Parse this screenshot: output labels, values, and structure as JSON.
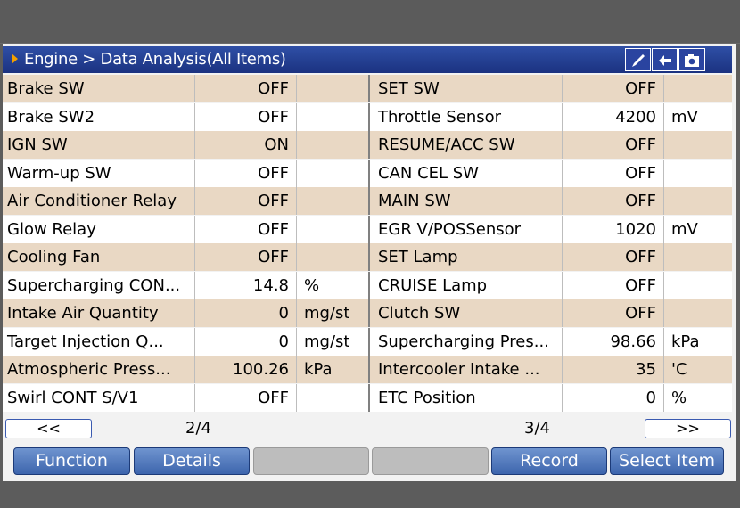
{
  "header": {
    "breadcrumb": "Engine > Data Analysis(All Items)"
  },
  "toolbar": {
    "icons": [
      "brush-icon",
      "back-arrow-icon",
      "camera-icon"
    ]
  },
  "rows": [
    {
      "left": {
        "name": "Brake SW",
        "value": "OFF",
        "unit": ""
      },
      "right": {
        "name": "SET SW",
        "value": "OFF",
        "unit": ""
      }
    },
    {
      "left": {
        "name": "Brake SW2",
        "value": "OFF",
        "unit": ""
      },
      "right": {
        "name": "Throttle Sensor",
        "value": "4200",
        "unit": "mV"
      }
    },
    {
      "left": {
        "name": "IGN SW",
        "value": "ON",
        "unit": ""
      },
      "right": {
        "name": "RESUME/ACC SW",
        "value": "OFF",
        "unit": ""
      }
    },
    {
      "left": {
        "name": "Warm-up SW",
        "value": "OFF",
        "unit": ""
      },
      "right": {
        "name": "CAN CEL SW",
        "value": "OFF",
        "unit": ""
      }
    },
    {
      "left": {
        "name": "Air Conditioner Relay",
        "value": "OFF",
        "unit": ""
      },
      "right": {
        "name": "MAIN SW",
        "value": "OFF",
        "unit": ""
      }
    },
    {
      "left": {
        "name": "Glow Relay",
        "value": "OFF",
        "unit": ""
      },
      "right": {
        "name": "EGR V/POSSensor",
        "value": "1020",
        "unit": "mV"
      }
    },
    {
      "left": {
        "name": "Cooling Fan",
        "value": "OFF",
        "unit": ""
      },
      "right": {
        "name": "SET Lamp",
        "value": "OFF",
        "unit": ""
      }
    },
    {
      "left": {
        "name": "Supercharging CON...",
        "value": "14.8",
        "unit": "%"
      },
      "right": {
        "name": "CRUISE Lamp",
        "value": "OFF",
        "unit": ""
      }
    },
    {
      "left": {
        "name": "Intake Air Quantity",
        "value": "0",
        "unit": "mg/st"
      },
      "right": {
        "name": "Clutch SW",
        "value": "OFF",
        "unit": ""
      }
    },
    {
      "left": {
        "name": "Target Injection Q...",
        "value": "0",
        "unit": "mg/st"
      },
      "right": {
        "name": "Supercharging Pres...",
        "value": "98.66",
        "unit": "kPa"
      }
    },
    {
      "left": {
        "name": "Atmospheric Press...",
        "value": "100.26",
        "unit": "kPa"
      },
      "right": {
        "name": "Intercooler Intake ...",
        "value": "35",
        "unit": "'C"
      }
    },
    {
      "left": {
        "name": "Swirl CONT S/V1",
        "value": "OFF",
        "unit": ""
      },
      "right": {
        "name": "ETC Position",
        "value": "0",
        "unit": "%"
      }
    }
  ],
  "nav": {
    "prev_label": "<<",
    "next_label": ">>",
    "left_page": "2/4",
    "right_page": "3/4"
  },
  "buttons": {
    "function": "Function",
    "details": "Details",
    "blank1": "",
    "blank2": "",
    "record": "Record",
    "select_item": "Select Item"
  }
}
